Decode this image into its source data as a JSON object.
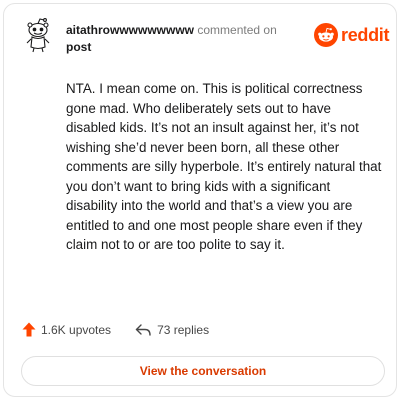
{
  "header": {
    "username": "aitathrowwwwwwwww",
    "action_text": "commented on",
    "post_link": "post",
    "brand_name": "reddit",
    "brand_color": "#ff4500"
  },
  "comment": {
    "body": "NTA. I mean come on. This is political correctness gone mad. Who deliberately sets out to have disabled kids. It’s not an insult against her, it’s not wishing she’d never been born, all these other comments are silly hyperbole. It’s entirely natural that you don’t want to bring kids with a significant disability into the world and that’s a view you are entitled to and one most people share even if they claim not to or are too polite to say it."
  },
  "stats": {
    "upvotes": "1.6K upvotes",
    "replies": "73 replies",
    "upvote_icon": "upvote-arrow-icon",
    "reply_icon": "reply-arrow-icon"
  },
  "cta": {
    "label": "View the conversation",
    "color": "#d93a00"
  }
}
